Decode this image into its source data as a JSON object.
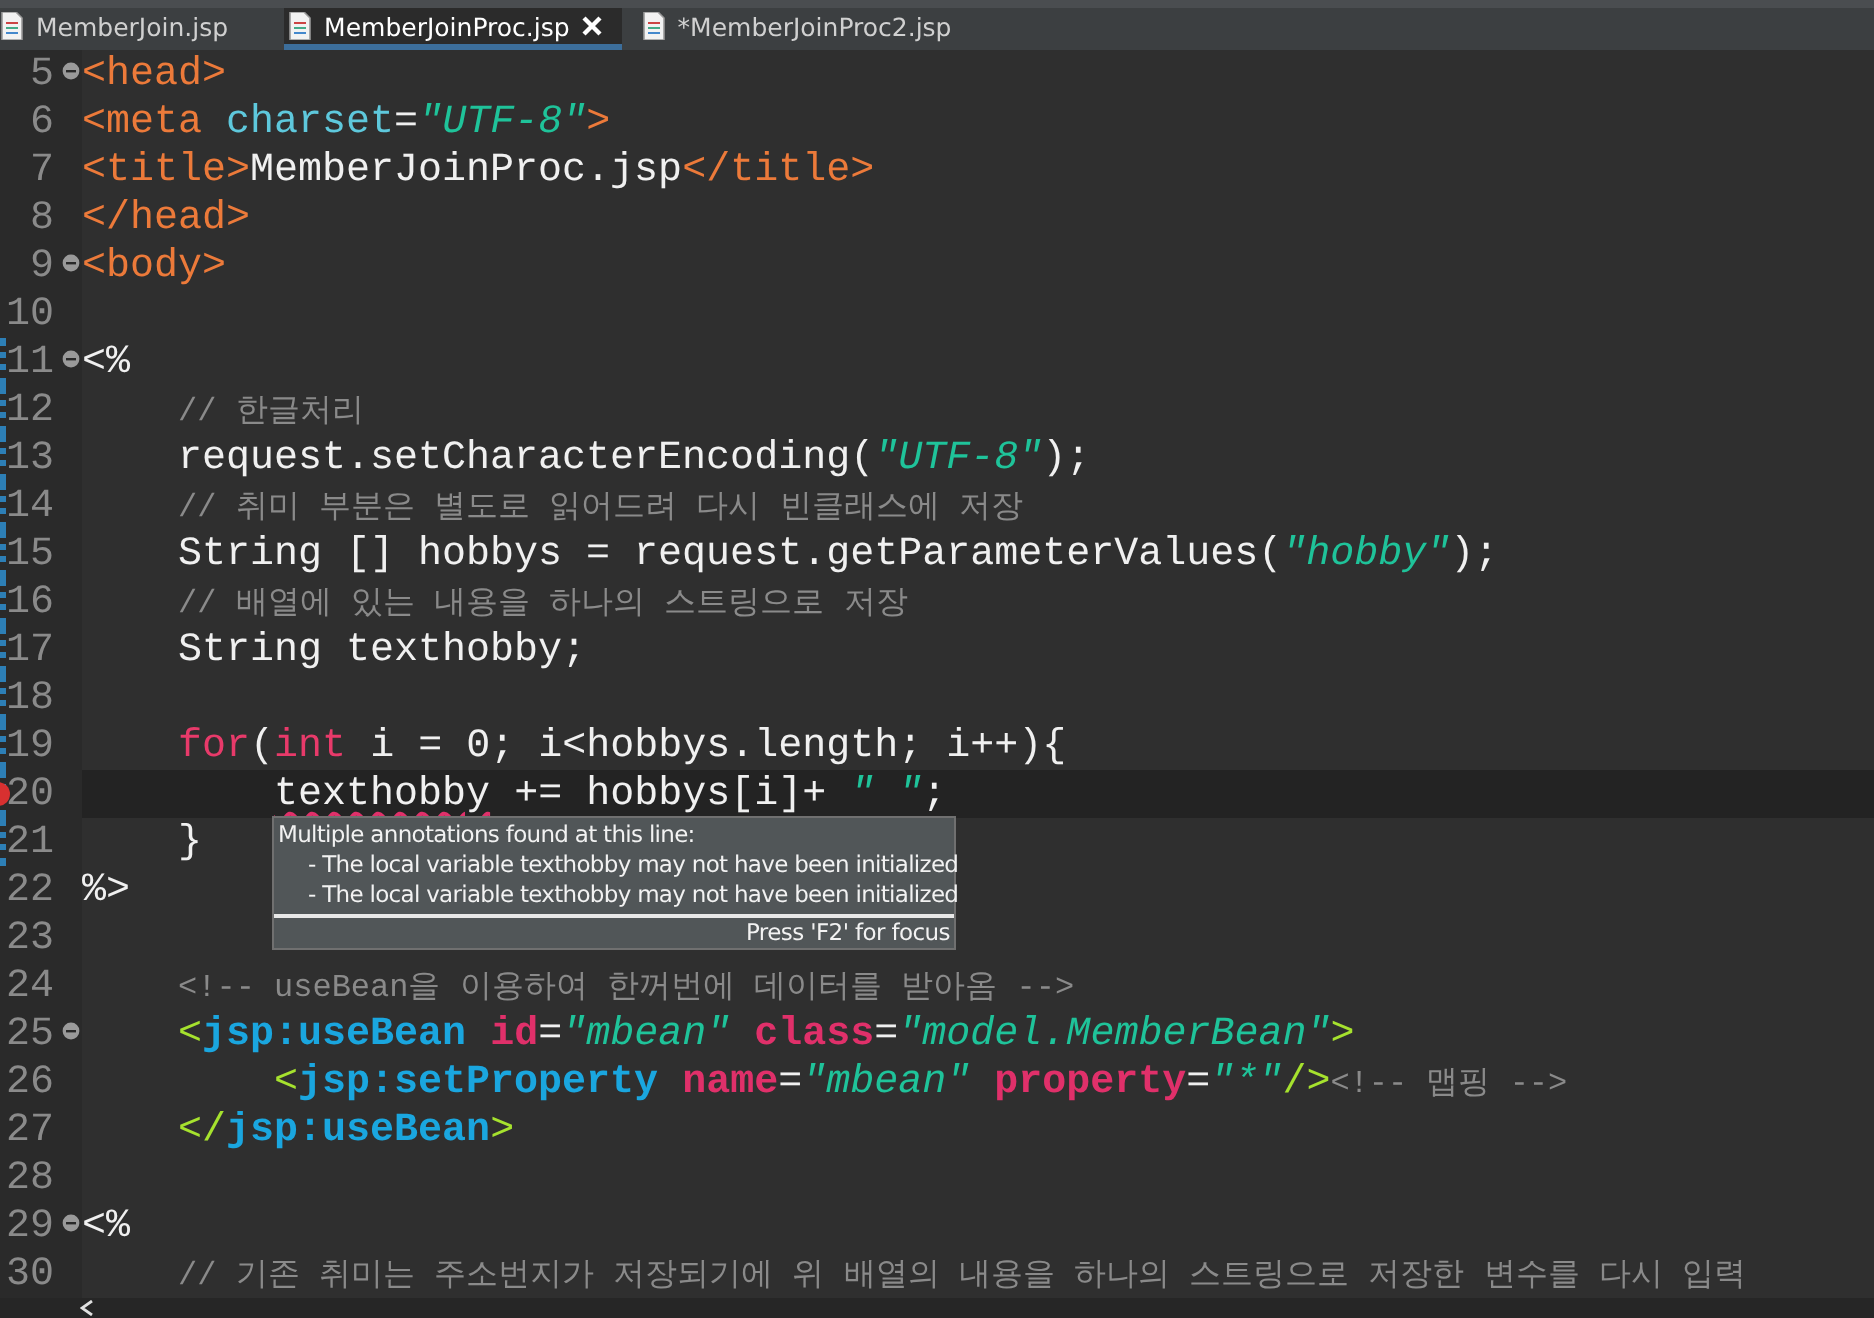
{
  "tabs": [
    {
      "label": "MemberJoin.jsp",
      "selected": false
    },
    {
      "label": "MemberJoinProc.jsp",
      "selected": true
    },
    {
      "label": "*MemberJoinProc2.jsp",
      "selected": false
    }
  ],
  "lines": [
    {
      "n": "5",
      "fold": true,
      "changed": false,
      "current": false,
      "error": false,
      "tokens": [
        {
          "kind": "tag",
          "t": "<head>"
        }
      ]
    },
    {
      "n": "6",
      "fold": false,
      "changed": false,
      "current": false,
      "error": false,
      "tokens": [
        {
          "kind": "tag",
          "t": "<meta"
        },
        {
          "kind": "attr",
          "t": " charset"
        },
        {
          "kind": "text",
          "t": "="
        },
        {
          "kind": "str",
          "t": "\"UTF-8\""
        },
        {
          "kind": "tag",
          "t": ">"
        }
      ]
    },
    {
      "n": "7",
      "fold": false,
      "changed": false,
      "current": false,
      "error": false,
      "tokens": [
        {
          "kind": "tag",
          "t": "<title>"
        },
        {
          "kind": "text",
          "t": "MemberJoinProc.jsp"
        },
        {
          "kind": "tag",
          "t": "</title>"
        }
      ]
    },
    {
      "n": "8",
      "fold": false,
      "changed": false,
      "current": false,
      "error": false,
      "tokens": [
        {
          "kind": "tag",
          "t": "</head>"
        }
      ]
    },
    {
      "n": "9",
      "fold": true,
      "changed": false,
      "current": false,
      "error": false,
      "tokens": [
        {
          "kind": "tag",
          "t": "<body>"
        }
      ]
    },
    {
      "n": "10",
      "fold": false,
      "changed": false,
      "current": false,
      "error": false
    },
    {
      "n": "11",
      "fold": true,
      "changed": true,
      "current": false,
      "error": false,
      "tokens": [
        {
          "kind": "text",
          "t": "<%"
        }
      ]
    },
    {
      "n": "12",
      "fold": false,
      "changed": true,
      "current": false,
      "error": false,
      "tokens": [
        {
          "kind": "cmt",
          "t": "    // 한글처리"
        }
      ]
    },
    {
      "n": "13",
      "fold": false,
      "changed": true,
      "current": false,
      "error": false,
      "tokens": [
        {
          "kind": "text",
          "t": "    request.setCharacterEncoding("
        },
        {
          "kind": "jstr",
          "t": "\"UTF-8\""
        },
        {
          "kind": "text",
          "t": ");"
        }
      ]
    },
    {
      "n": "14",
      "fold": false,
      "changed": true,
      "current": false,
      "error": false,
      "tokens": [
        {
          "kind": "cmt",
          "t": "    // 취미 부분은 별도로 읽어드려 다시 빈클래스에 저장"
        }
      ]
    },
    {
      "n": "15",
      "fold": false,
      "changed": true,
      "current": false,
      "error": false,
      "tokens": [
        {
          "kind": "text",
          "t": "    String [] hobbys = request.getParameterValues("
        },
        {
          "kind": "jstr",
          "t": "\"hobby\""
        },
        {
          "kind": "text",
          "t": ");"
        }
      ]
    },
    {
      "n": "16",
      "fold": false,
      "changed": true,
      "current": false,
      "error": false,
      "tokens": [
        {
          "kind": "cmt",
          "t": "    // 배열에 있는 내용을 하나의 스트링으로 저장"
        }
      ]
    },
    {
      "n": "17",
      "fold": false,
      "changed": true,
      "current": false,
      "error": false,
      "tokens": [
        {
          "kind": "text",
          "t": "    String texthobby;"
        }
      ]
    },
    {
      "n": "18",
      "fold": false,
      "changed": true,
      "current": false,
      "error": false
    },
    {
      "n": "19",
      "fold": false,
      "changed": true,
      "current": false,
      "error": false,
      "tokens": [
        {
          "kind": "kw",
          "t": "    for"
        },
        {
          "kind": "text",
          "t": "("
        },
        {
          "kind": "kw",
          "t": "int"
        },
        {
          "kind": "text",
          "t": " i = 0; i<hobbys.length; i++){"
        }
      ]
    },
    {
      "n": "20",
      "fold": false,
      "changed": true,
      "current": true,
      "error": true,
      "tokens": [
        {
          "kind": "err",
          "t": "        texthobby"
        },
        {
          "kind": "text",
          "t": " += hobbys[i]+ "
        },
        {
          "kind": "jstr",
          "t": "\" \""
        },
        {
          "kind": "text",
          "t": ";"
        }
      ]
    },
    {
      "n": "21",
      "fold": false,
      "changed": true,
      "current": false,
      "error": false,
      "tokens": [
        {
          "kind": "text",
          "t": "    }"
        }
      ]
    },
    {
      "n": "22",
      "fold": false,
      "changed": false,
      "current": false,
      "error": false,
      "tokens": [
        {
          "kind": "text",
          "t": "%>"
        }
      ]
    },
    {
      "n": "23",
      "fold": false,
      "changed": false,
      "current": false,
      "error": false
    },
    {
      "n": "24",
      "fold": false,
      "changed": false,
      "current": false,
      "error": false,
      "tokens": [
        {
          "kind": "cmt",
          "t": "    <!-- useBean을 이용하여 한꺼번에 데이터를 받아옴 -->"
        }
      ]
    },
    {
      "n": "25",
      "fold": true,
      "changed": false,
      "current": false,
      "error": false,
      "tokens": [
        {
          "kind": "jb",
          "t": "    <"
        },
        {
          "kind": "jsp",
          "t": "jsp:useBean"
        },
        {
          "kind": "jattr",
          "t": " id"
        },
        {
          "kind": "text",
          "t": "="
        },
        {
          "kind": "jstr",
          "t": "\"mbean\""
        },
        {
          "kind": "jattr",
          "t": " class"
        },
        {
          "kind": "text",
          "t": "="
        },
        {
          "kind": "jstr",
          "t": "\"model.MemberBean\""
        },
        {
          "kind": "jb",
          "t": ">"
        }
      ]
    },
    {
      "n": "26",
      "fold": false,
      "changed": false,
      "current": false,
      "error": false,
      "tokens": [
        {
          "kind": "jb",
          "t": "        <"
        },
        {
          "kind": "jsp",
          "t": "jsp:setProperty"
        },
        {
          "kind": "jattr",
          "t": " name"
        },
        {
          "kind": "text",
          "t": "="
        },
        {
          "kind": "jstr",
          "t": "\"mbean\""
        },
        {
          "kind": "jattr",
          "t": " property"
        },
        {
          "kind": "text",
          "t": "="
        },
        {
          "kind": "jstr",
          "t": "\"*\""
        },
        {
          "kind": "jb",
          "t": "/>"
        },
        {
          "kind": "cmt",
          "t": "<!-- 맵핑 -->"
        }
      ]
    },
    {
      "n": "27",
      "fold": false,
      "changed": false,
      "current": false,
      "error": false,
      "tokens": [
        {
          "kind": "jb",
          "t": "    </"
        },
        {
          "kind": "jsp",
          "t": "jsp:useBean"
        },
        {
          "kind": "jb",
          "t": ">"
        }
      ]
    },
    {
      "n": "28",
      "fold": false,
      "changed": false,
      "current": false,
      "error": false
    },
    {
      "n": "29",
      "fold": true,
      "changed": false,
      "current": false,
      "error": false,
      "tokens": [
        {
          "kind": "text",
          "t": "<%"
        }
      ]
    },
    {
      "n": "30",
      "fold": false,
      "changed": false,
      "current": false,
      "error": false,
      "tokens": [
        {
          "kind": "cmt",
          "t": "    // 기존 취미는 주소번지가 저장되기에 위 배열의 내용을 하나의 스트링으로 저장한 변수를 다시 입력"
        }
      ]
    }
  ],
  "tooltip": {
    "title": "Multiple annotations found at this line:",
    "items": [
      "- The local variable texthobby may not have been initialized",
      "- The local variable texthobby may not have been initialized"
    ],
    "footer": "Press 'F2' for focus"
  }
}
